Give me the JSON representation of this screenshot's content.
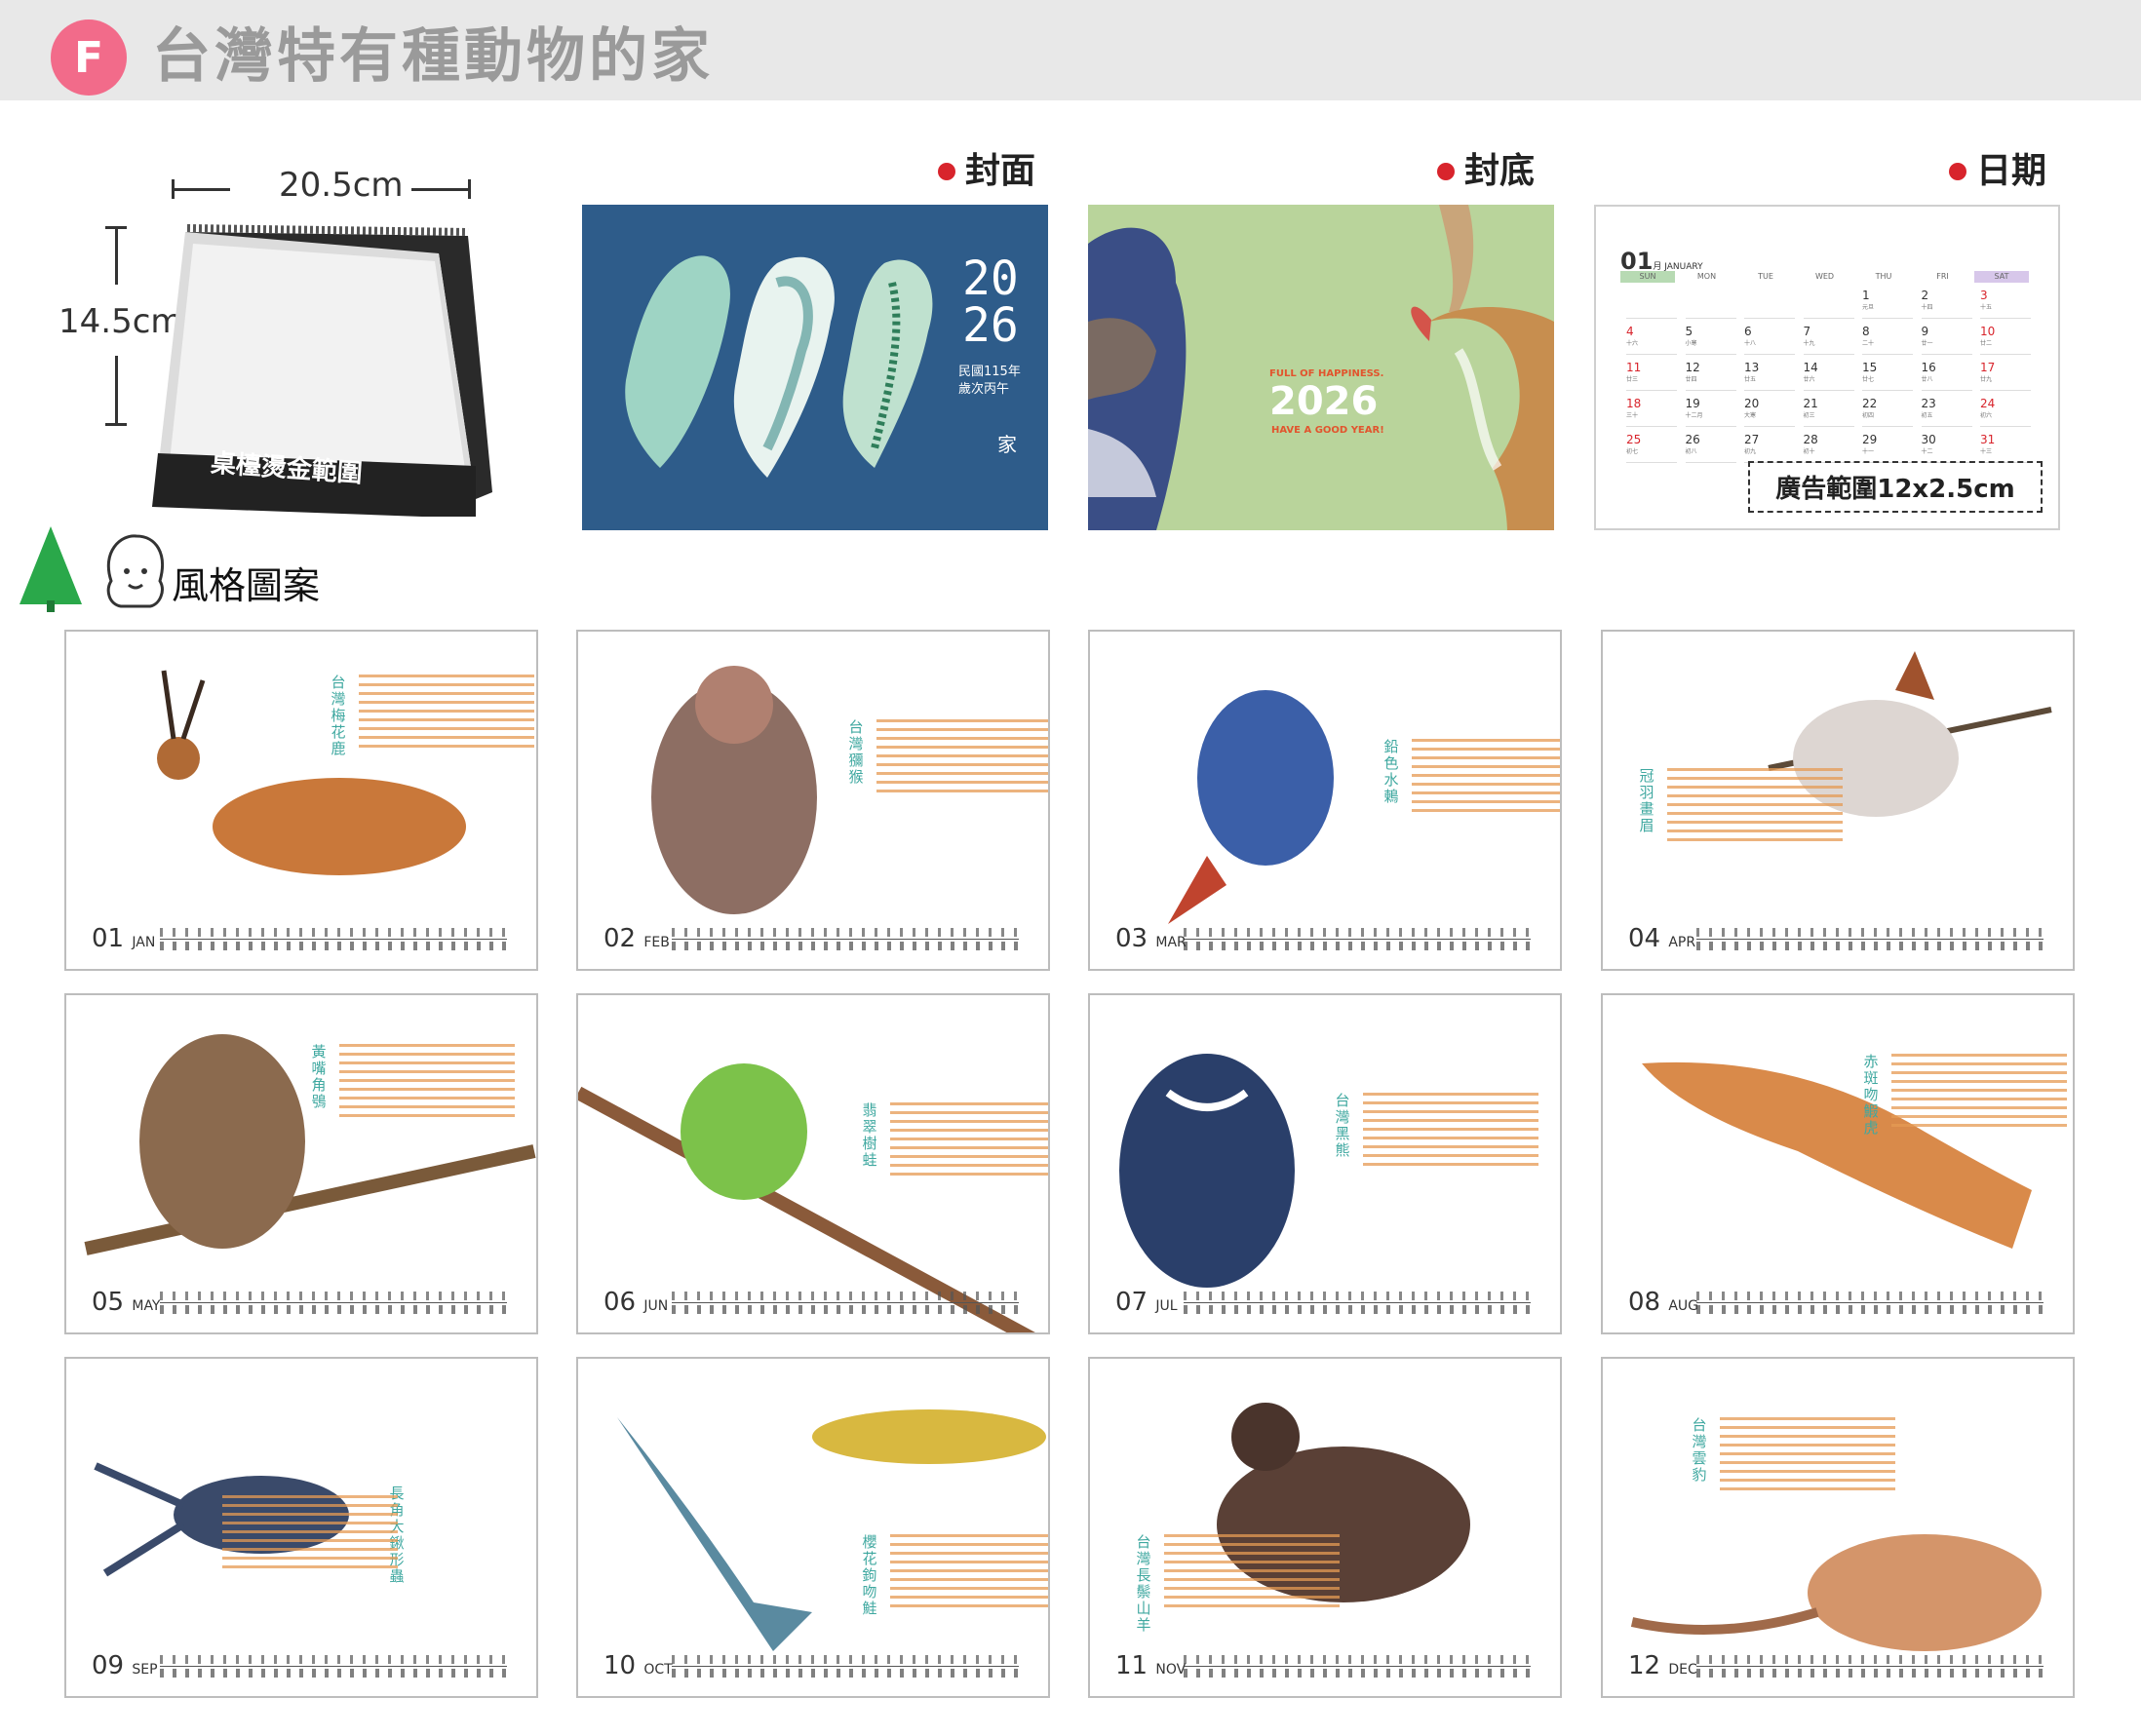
{
  "header": {
    "badge": "F",
    "title": "台灣特有種動物的家"
  },
  "product": {
    "width_label": "20.5cm",
    "height_label": "14.5cm",
    "base_text": "桌檯燙金範圍"
  },
  "sections": {
    "cover": "封面",
    "back": "封底",
    "date": "日期",
    "style": "風格圖案"
  },
  "cover": {
    "year_top": "20",
    "year_bottom": "26",
    "roc_year": "民國115年",
    "ganzhi": "歲次丙午",
    "brand": "家"
  },
  "back": {
    "line1": "FULL OF HAPPINESS.",
    "year": "2026",
    "line2": "HAVE A GOOD YEAR!"
  },
  "date_sample": {
    "month": "01",
    "month_name": "月 JANUARY",
    "weekdays": [
      "SUN",
      "MON",
      "TUE",
      "WED",
      "THU",
      "FRI",
      "SAT"
    ],
    "weeks": [
      [
        {
          "d": "",
          "l": ""
        },
        {
          "d": "",
          "l": ""
        },
        {
          "d": "",
          "l": ""
        },
        {
          "d": "",
          "l": ""
        },
        {
          "d": "1",
          "l": "元旦"
        },
        {
          "d": "2",
          "l": "十四"
        },
        {
          "d": "3",
          "l": "十五"
        }
      ],
      [
        {
          "d": "4",
          "l": "十六"
        },
        {
          "d": "5",
          "l": "小寒"
        },
        {
          "d": "6",
          "l": "十八"
        },
        {
          "d": "7",
          "l": "十九"
        },
        {
          "d": "8",
          "l": "二十"
        },
        {
          "d": "9",
          "l": "廿一"
        },
        {
          "d": "10",
          "l": "廿二"
        }
      ],
      [
        {
          "d": "11",
          "l": "廿三"
        },
        {
          "d": "12",
          "l": "廿四"
        },
        {
          "d": "13",
          "l": "廿五"
        },
        {
          "d": "14",
          "l": "廿六"
        },
        {
          "d": "15",
          "l": "廿七"
        },
        {
          "d": "16",
          "l": "廿八"
        },
        {
          "d": "17",
          "l": "廿九"
        }
      ],
      [
        {
          "d": "18",
          "l": "三十"
        },
        {
          "d": "19",
          "l": "十二月"
        },
        {
          "d": "20",
          "l": "大寒"
        },
        {
          "d": "21",
          "l": "初三"
        },
        {
          "d": "22",
          "l": "初四"
        },
        {
          "d": "23",
          "l": "初五"
        },
        {
          "d": "24",
          "l": "初六"
        }
      ],
      [
        {
          "d": "25",
          "l": "初七"
        },
        {
          "d": "26",
          "l": "初八"
        },
        {
          "d": "27",
          "l": "初九"
        },
        {
          "d": "28",
          "l": "初十"
        },
        {
          "d": "29",
          "l": "十一"
        },
        {
          "d": "30",
          "l": "十二"
        },
        {
          "d": "31",
          "l": "十三"
        }
      ]
    ],
    "ad_text": "廣告範圍12x2.5cm"
  },
  "months": [
    {
      "num": "01",
      "abbr": "JAN",
      "animal": "台灣梅花鹿"
    },
    {
      "num": "02",
      "abbr": "FEB",
      "animal": "台灣獼猴"
    },
    {
      "num": "03",
      "abbr": "MAR",
      "animal": "鉛色水鶇"
    },
    {
      "num": "04",
      "abbr": "APR",
      "animal": "冠羽畫眉"
    },
    {
      "num": "05",
      "abbr": "MAY",
      "animal": "黃嘴角鴞"
    },
    {
      "num": "06",
      "abbr": "JUN",
      "animal": "翡翠樹蛙"
    },
    {
      "num": "07",
      "abbr": "JUL",
      "animal": "台灣黑熊"
    },
    {
      "num": "08",
      "abbr": "AUG",
      "animal": "赤斑吻鰕虎"
    },
    {
      "num": "09",
      "abbr": "SEP",
      "animal": "長角大鍬形蟲"
    },
    {
      "num": "10",
      "abbr": "OCT",
      "animal": "櫻花鉤吻鮭"
    },
    {
      "num": "11",
      "abbr": "NOV",
      "animal": "台灣長鬃山羊"
    },
    {
      "num": "12",
      "abbr": "DEC",
      "animal": "台灣雲豹"
    }
  ],
  "colors": {
    "accent_pink": "#f26b8a",
    "dot_red": "#d8242c",
    "cover_blue": "#2e5c8a",
    "back_green": "#b9d49b",
    "sat_purple": "#d7c7ea",
    "sun_green": "#b7dab3"
  }
}
